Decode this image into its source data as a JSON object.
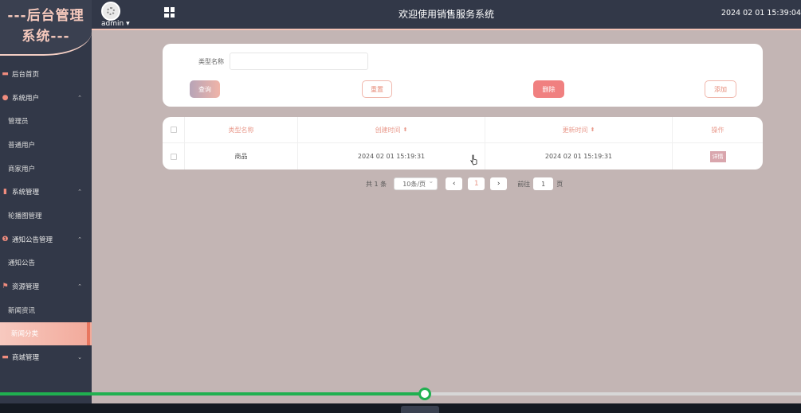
{
  "logo": {
    "line1": "---后台管理",
    "line2": "系统---"
  },
  "header": {
    "user": "admin",
    "title": "欢迎使用销售服务系统",
    "clock": "2024 02 01 15:39:04"
  },
  "sidebar": {
    "items": [
      {
        "label": "后台首页",
        "type": "parent",
        "icon": "monitor-icon",
        "chev": ""
      },
      {
        "label": "系统用户",
        "type": "parent",
        "icon": "user-icon",
        "chev": "⌃"
      },
      {
        "label": "管理员",
        "type": "sub"
      },
      {
        "label": "普通用户",
        "type": "sub"
      },
      {
        "label": "商家用户",
        "type": "sub"
      },
      {
        "label": "系统管理",
        "type": "parent",
        "icon": "bar-chart-icon",
        "chev": "⌃"
      },
      {
        "label": "轮播图管理",
        "type": "sub"
      },
      {
        "label": "通知公告管理",
        "type": "parent",
        "icon": "alert-icon",
        "chev": "⌃"
      },
      {
        "label": "通知公告",
        "type": "sub"
      },
      {
        "label": "资源管理",
        "type": "parent",
        "icon": "flag-icon",
        "chev": "⌃"
      },
      {
        "label": "新闻资讯",
        "type": "sub"
      },
      {
        "label": "新闻分类",
        "type": "sub",
        "active": true
      },
      {
        "label": "商城管理",
        "type": "parent",
        "icon": "store-icon",
        "chev": "⌄"
      }
    ]
  },
  "search": {
    "label": "类型名称",
    "value": "",
    "query_label": "查询",
    "reset_label": "重置",
    "delete_label": "删除",
    "add_label": "添加"
  },
  "table": {
    "headers": [
      "类型名称",
      "创建时间",
      "更新时间",
      "操作"
    ],
    "rows": [
      {
        "name": "商品",
        "created": "2024 02 01 15:19:31",
        "updated": "2024 02 01 15:19:31",
        "action": "详情"
      }
    ]
  },
  "pager": {
    "total": "共 1 条",
    "size": "10条/页",
    "prev": "‹",
    "page": "1",
    "next": "›",
    "goto_label": "前往",
    "goto_value": "1",
    "page_suffix": "页"
  },
  "media": {
    "progress": 0.53
  },
  "colors": {
    "accent": "#f08080",
    "sidebar": "#323848",
    "content": "#c3b5b4",
    "progress": "#20b050"
  }
}
